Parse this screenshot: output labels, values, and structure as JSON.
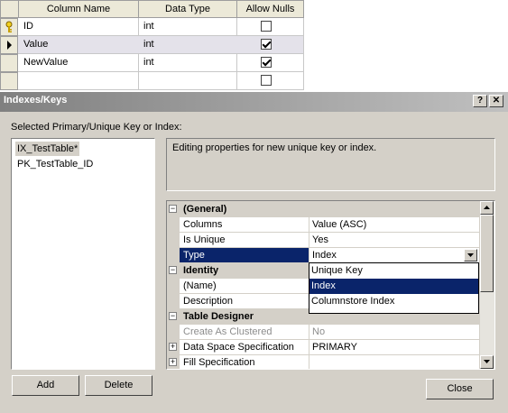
{
  "grid": {
    "headers": [
      "Column Name",
      "Data Type",
      "Allow Nulls"
    ],
    "rows": [
      {
        "name": "ID",
        "type": "int",
        "allow_nulls": false,
        "primary_key": true
      },
      {
        "name": "Value",
        "type": "int",
        "allow_nulls": true,
        "current": true
      },
      {
        "name": "NewValue",
        "type": "int",
        "allow_nulls": true
      },
      {
        "name": "",
        "type": "",
        "allow_nulls": false
      }
    ]
  },
  "dialog": {
    "title": "Indexes/Keys",
    "help_btn": "?",
    "close_btn": "✕",
    "list_label": "Selected Primary/Unique Key or Index:",
    "list_items": [
      "IX_TestTable*",
      "PK_TestTable_ID"
    ],
    "description": "Editing properties for new unique key or index.",
    "add": "Add",
    "delete": "Delete",
    "close": "Close"
  },
  "properties": {
    "general": {
      "label": "(General)",
      "columns": {
        "name": "Columns",
        "value": "Value (ASC)"
      },
      "is_unique": {
        "name": "Is Unique",
        "value": "Yes"
      },
      "type": {
        "name": "Type",
        "value": "Index"
      }
    },
    "identity": {
      "label": "Identity",
      "name_row": {
        "name": "(Name)",
        "value": ""
      },
      "description_row": {
        "name": "Description",
        "value": ""
      }
    },
    "table_designer": {
      "label": "Table Designer",
      "create_as_clustered": {
        "name": "Create As Clustered",
        "value": "No"
      },
      "data_space": {
        "name": "Data Space Specification",
        "value": "PRIMARY"
      },
      "fill_spec": {
        "name": "Fill Specification",
        "value": ""
      }
    }
  },
  "type_dropdown": {
    "options": [
      "Unique Key",
      "Index",
      "Columnstore Index"
    ],
    "selected": "Index"
  },
  "colors": {
    "selection": "#0a246a",
    "dialog_face": "#d4d0c8"
  }
}
